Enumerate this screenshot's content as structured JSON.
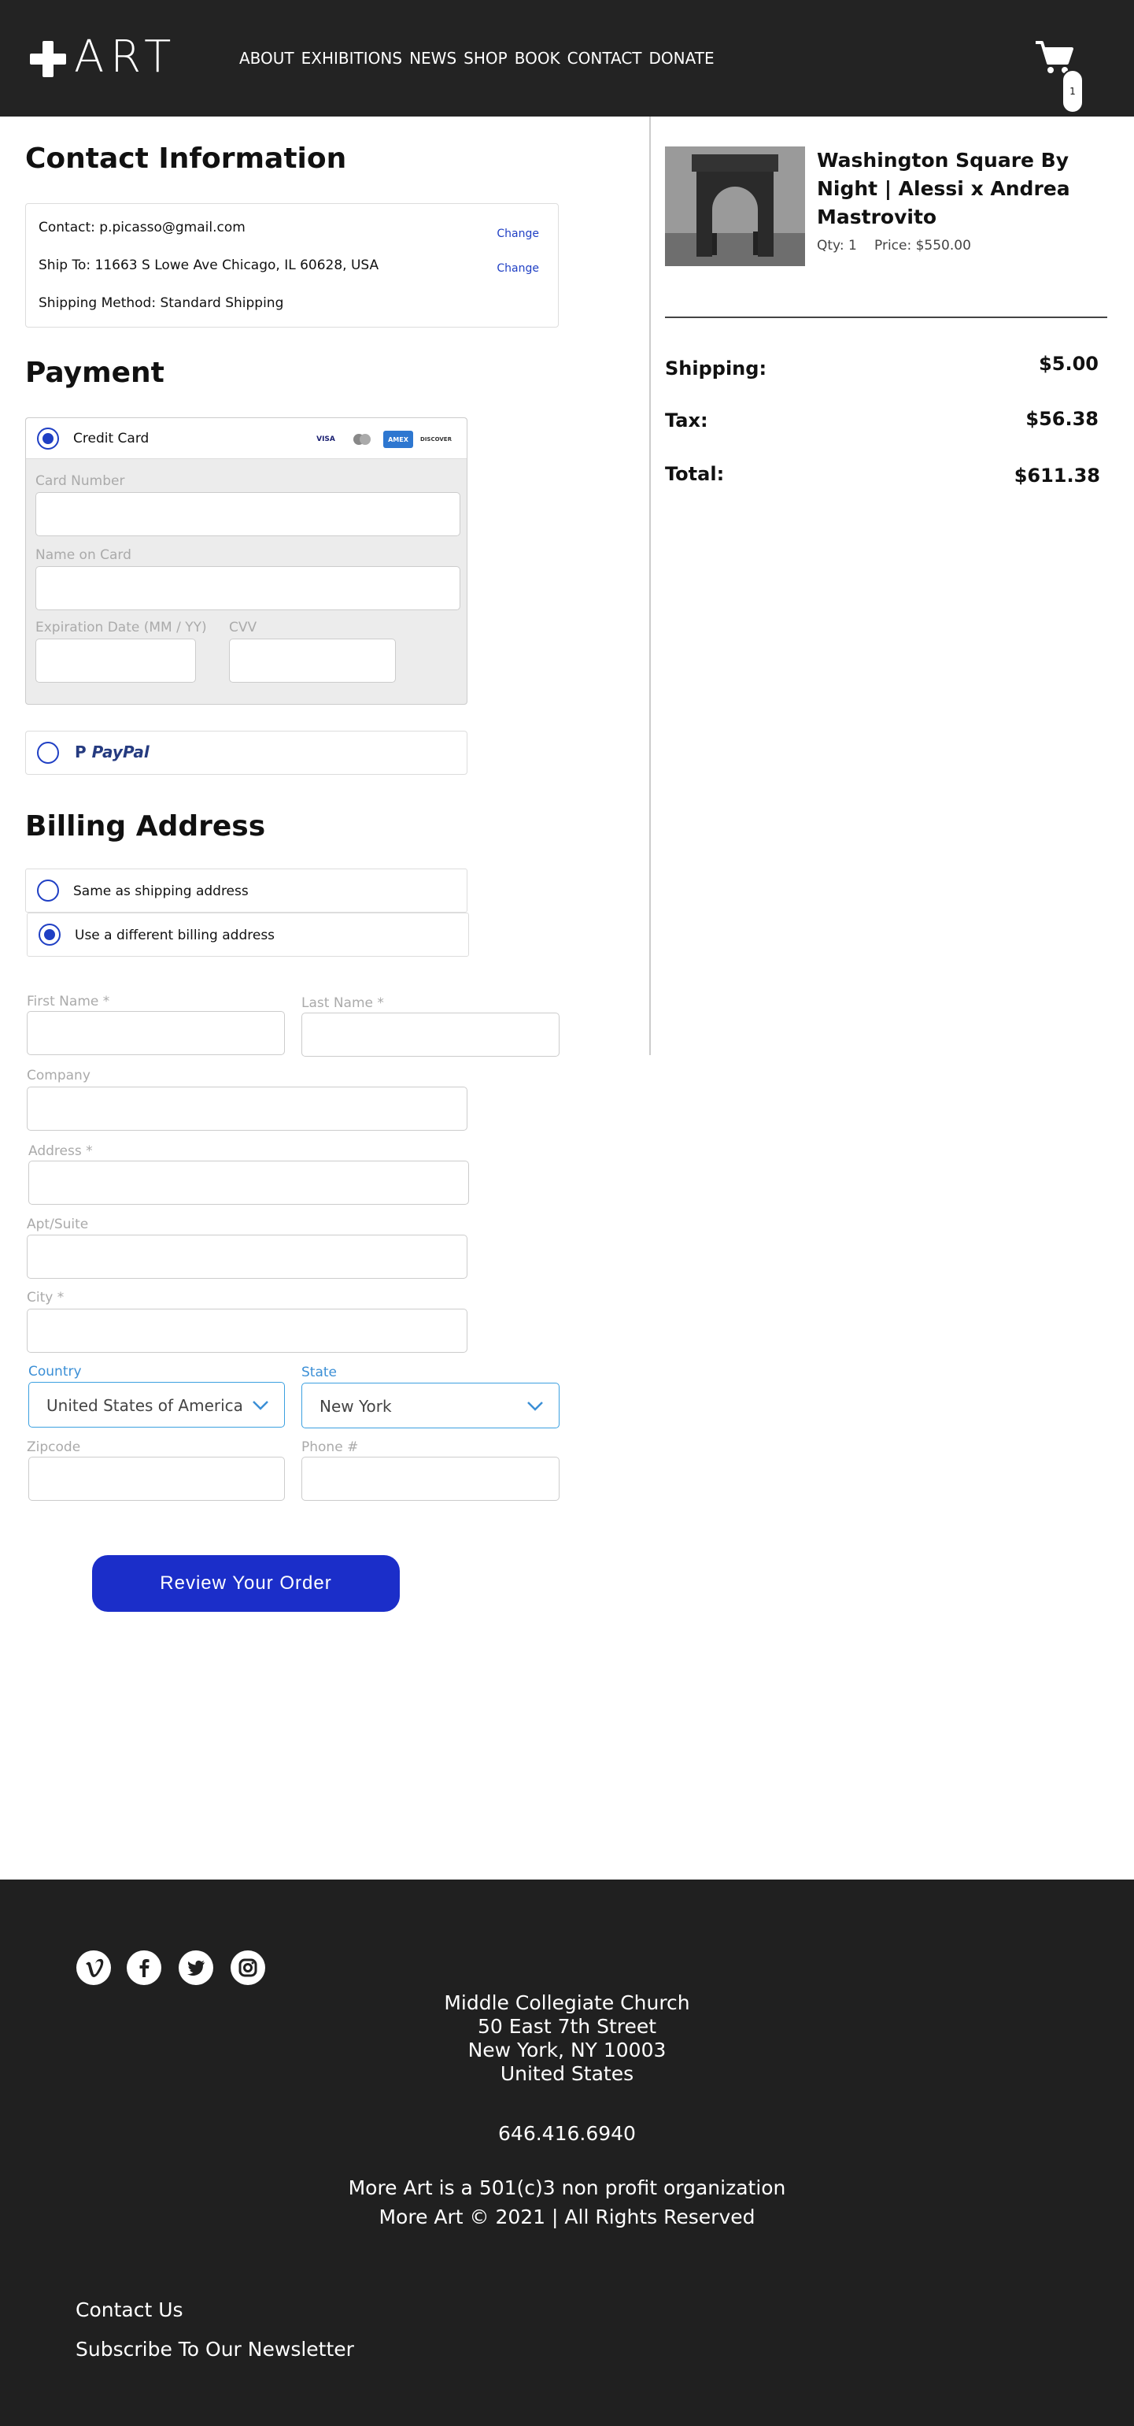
{
  "header": {
    "logo_text": "ART",
    "nav": [
      "ABOUT",
      "EXHIBITIONS",
      "NEWS",
      "SHOP",
      "BOOK",
      "CONTACT",
      "DONATE"
    ],
    "cart_count": "1"
  },
  "contact": {
    "title": "Contact Information",
    "contact_line": "Contact: p.picasso@gmail.com",
    "ship_line": "Ship To: 11663 S Lowe Ave Chicago, IL 60628, USA",
    "method_line": "Shipping Method: Standard Shipping",
    "change_label": "Change"
  },
  "payment": {
    "title": "Payment",
    "credit_label": "Credit Card",
    "card_brands": [
      "VISA",
      "MC",
      "AMEX",
      "DISCOVER"
    ],
    "card_number_label": "Card Number",
    "name_label": "Name on Card",
    "expiry_label": "Expiration Date (MM / YY)",
    "cvv_label": "CVV",
    "paypal_label": "PayPal"
  },
  "billing": {
    "title": "Billing Address",
    "same_label": "Same as shipping address",
    "different_label": "Use a different billing address",
    "first_name": "First Name *",
    "last_name": "Last Name *",
    "company": "Company",
    "address": "Address *",
    "apt": "Apt/Suite",
    "city": "City *",
    "country_label": "Country",
    "country_value": "United States of America",
    "state_label": "State",
    "state_value": "New York",
    "zip": "Zipcode",
    "phone": "Phone #"
  },
  "review_button": "Review Your Order",
  "order": {
    "product_name": "Washington Square By Night | Alessi x Andrea Mastrovito",
    "qty": "Qty: 1",
    "price": "Price: $550.00",
    "shipping_label": "Shipping:",
    "shipping_value": "$5.00",
    "tax_label": "Tax:",
    "tax_value": "$56.38",
    "total_label": "Total:",
    "total_value": "$611.38"
  },
  "footer": {
    "address": [
      "Middle Collegiate Church",
      "50 East 7th Street",
      "New York, NY 10003",
      "United States"
    ],
    "phone": "646.416.6940",
    "nonprofit": "More Art is a 501(c)3 non profit organization",
    "copyright": "More Art © 2021 | All Rights Reserved",
    "contact_link": "Contact Us",
    "newsletter_link": "Subscribe To Our Newsletter"
  },
  "colors": {
    "accent": "#1b2ec9",
    "header_bg": "#232323",
    "footer_bg": "#202020"
  }
}
